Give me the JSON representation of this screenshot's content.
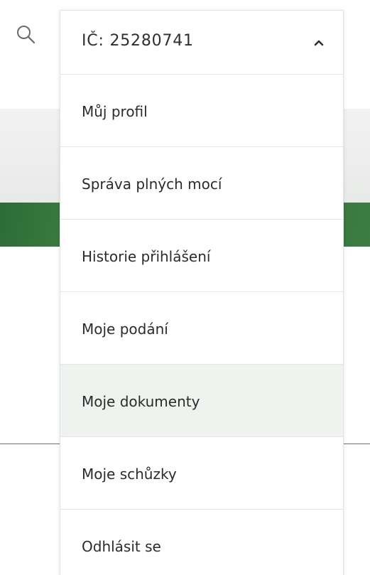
{
  "header": {
    "search_icon": "search-icon"
  },
  "account_dropdown": {
    "selected_label": "IČ: 25280741",
    "chevron_icon": "chevron-up-icon",
    "items": [
      {
        "label": "Můj profil",
        "active": false
      },
      {
        "label": "Správa plných mocí",
        "active": false
      },
      {
        "label": "Historie přihlášení",
        "active": false
      },
      {
        "label": "Moje podání",
        "active": false
      },
      {
        "label": "Moje dokumenty",
        "active": true
      },
      {
        "label": "Moje schůzky",
        "active": false
      },
      {
        "label": "Odhlásit se",
        "active": false
      }
    ]
  },
  "colors": {
    "highlight": "#eef3ef",
    "green_band": "#3a7c42",
    "text": "#2b2b2b",
    "divider": "#e6e6e6"
  }
}
